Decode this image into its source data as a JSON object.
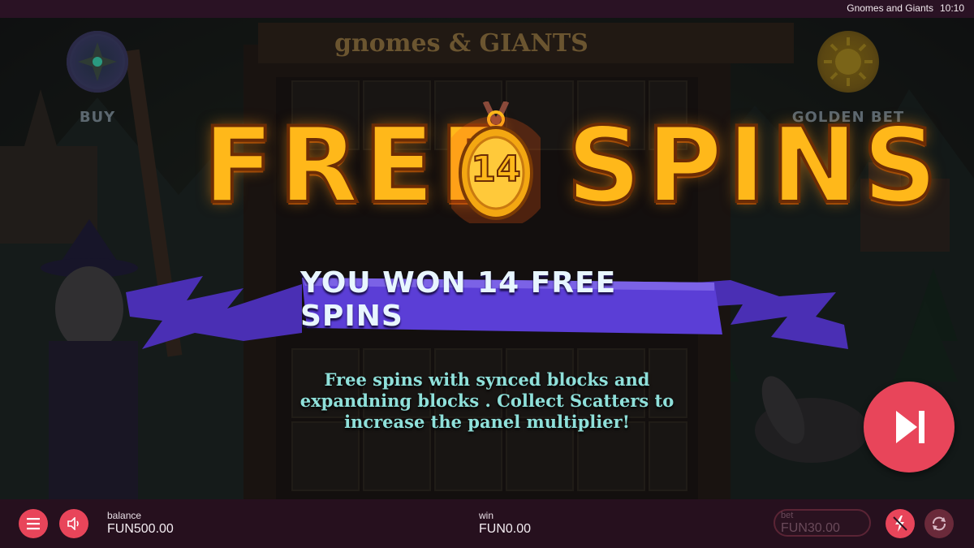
{
  "window": {
    "title": "Gnomes and Giants",
    "clock": "10:10"
  },
  "game": {
    "logo_text": "gnomes & GIANTS"
  },
  "side_buttons": {
    "buy_label": "BUY",
    "golden_bet_label": "GOLDEN BET"
  },
  "popup": {
    "title_left": "FREE",
    "title_right": "SPINS",
    "spins_count": "14",
    "banner": "YOU WON 14 FREE SPINS",
    "description": "Free spins with synced blocks and expandning blocks . Collect Scatters to increase the panel multiplier!"
  },
  "bottom_bar": {
    "balance_label": "balance",
    "balance_value": "FUN500.00",
    "win_label": "win",
    "win_value": "FUN0.00",
    "bet_label": "bet",
    "bet_value": "FUN30.00"
  },
  "colors": {
    "accent": "#e8455a",
    "title_gold": "#ffb81a",
    "banner_purple": "#5b3ed6",
    "description_teal": "#8fe0da",
    "bottom_bar": "#26101e"
  },
  "icons": [
    "menu-icon",
    "sound-icon",
    "skip-icon",
    "turbo-icon",
    "autoplay-icon",
    "wand-icon",
    "compass-icon",
    "sun-icon"
  ]
}
